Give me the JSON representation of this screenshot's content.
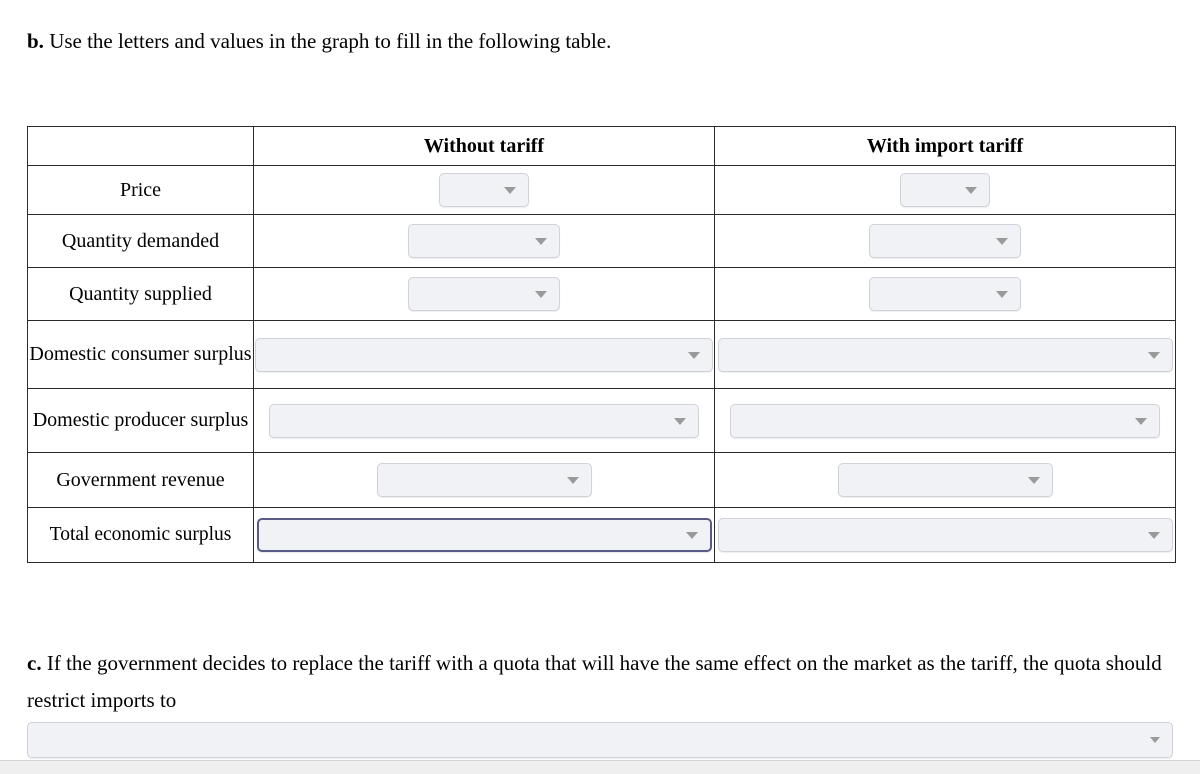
{
  "part_b": {
    "lead": "b.",
    "text": "Use the letters and values in the graph to fill in the following table."
  },
  "table": {
    "corner_header": "",
    "columns": [
      "Without tariff",
      "With import tariff"
    ],
    "rows": [
      {
        "label": "Price",
        "without_tariff": {
          "value": "",
          "placeholder": "",
          "focused": false
        },
        "with_import_tariff": {
          "value": "",
          "placeholder": "",
          "focused": false
        }
      },
      {
        "label": "Quantity demanded",
        "without_tariff": {
          "value": "",
          "placeholder": "",
          "focused": false
        },
        "with_import_tariff": {
          "value": "",
          "placeholder": "",
          "focused": false
        }
      },
      {
        "label": "Quantity supplied",
        "without_tariff": {
          "value": "",
          "placeholder": "",
          "focused": false
        },
        "with_import_tariff": {
          "value": "",
          "placeholder": "",
          "focused": false
        }
      },
      {
        "label": "Domestic consumer surplus",
        "without_tariff": {
          "value": "",
          "placeholder": "",
          "focused": false
        },
        "with_import_tariff": {
          "value": "",
          "placeholder": "",
          "focused": false
        }
      },
      {
        "label": "Domestic producer surplus",
        "without_tariff": {
          "value": "",
          "placeholder": "",
          "focused": false
        },
        "with_import_tariff": {
          "value": "",
          "placeholder": "",
          "focused": false
        }
      },
      {
        "label": "Government revenue",
        "without_tariff": {
          "value": "",
          "placeholder": "",
          "focused": false
        },
        "with_import_tariff": {
          "value": "",
          "placeholder": "",
          "focused": false
        }
      },
      {
        "label": "Total economic surplus",
        "without_tariff": {
          "value": "",
          "placeholder": "",
          "focused": true
        },
        "with_import_tariff": {
          "value": "",
          "placeholder": "",
          "focused": false
        }
      }
    ]
  },
  "part_c": {
    "lead": "c.",
    "text": "If the government decides to replace the tariff with a quota that will have the same effect on the market as the tariff, the quota should restrict imports to",
    "answer_dropdown": {
      "value": "",
      "placeholder": ""
    }
  },
  "icons": {
    "caret": "chevron-down-icon"
  },
  "colors": {
    "dropdown_fill": "#f1f2f6",
    "dropdown_border": "#cfd2d8",
    "dropdown_focus_border": "#5a5a86",
    "caret": "#9a9a9a",
    "table_border": "#2b2b2b",
    "page_background": "#ffffff",
    "bottom_bar": "#efefef"
  }
}
